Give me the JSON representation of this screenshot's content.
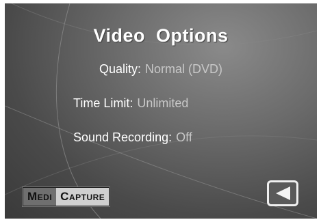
{
  "header": {
    "title": "Video Options"
  },
  "options": [
    {
      "label": "Quality:",
      "value": "Normal (DVD)"
    },
    {
      "label": "Time Limit:",
      "value": "Unlimited"
    },
    {
      "label": "Sound Recording:",
      "value": "Off"
    }
  ],
  "logo": {
    "part1": "Medi",
    "part2": "Capture"
  },
  "back_button": {
    "icon": "left-triangle-icon"
  },
  "colors": {
    "title": "#ffffff",
    "label": "#ffffff",
    "value": "#c8c8c8",
    "background": "#555555"
  }
}
